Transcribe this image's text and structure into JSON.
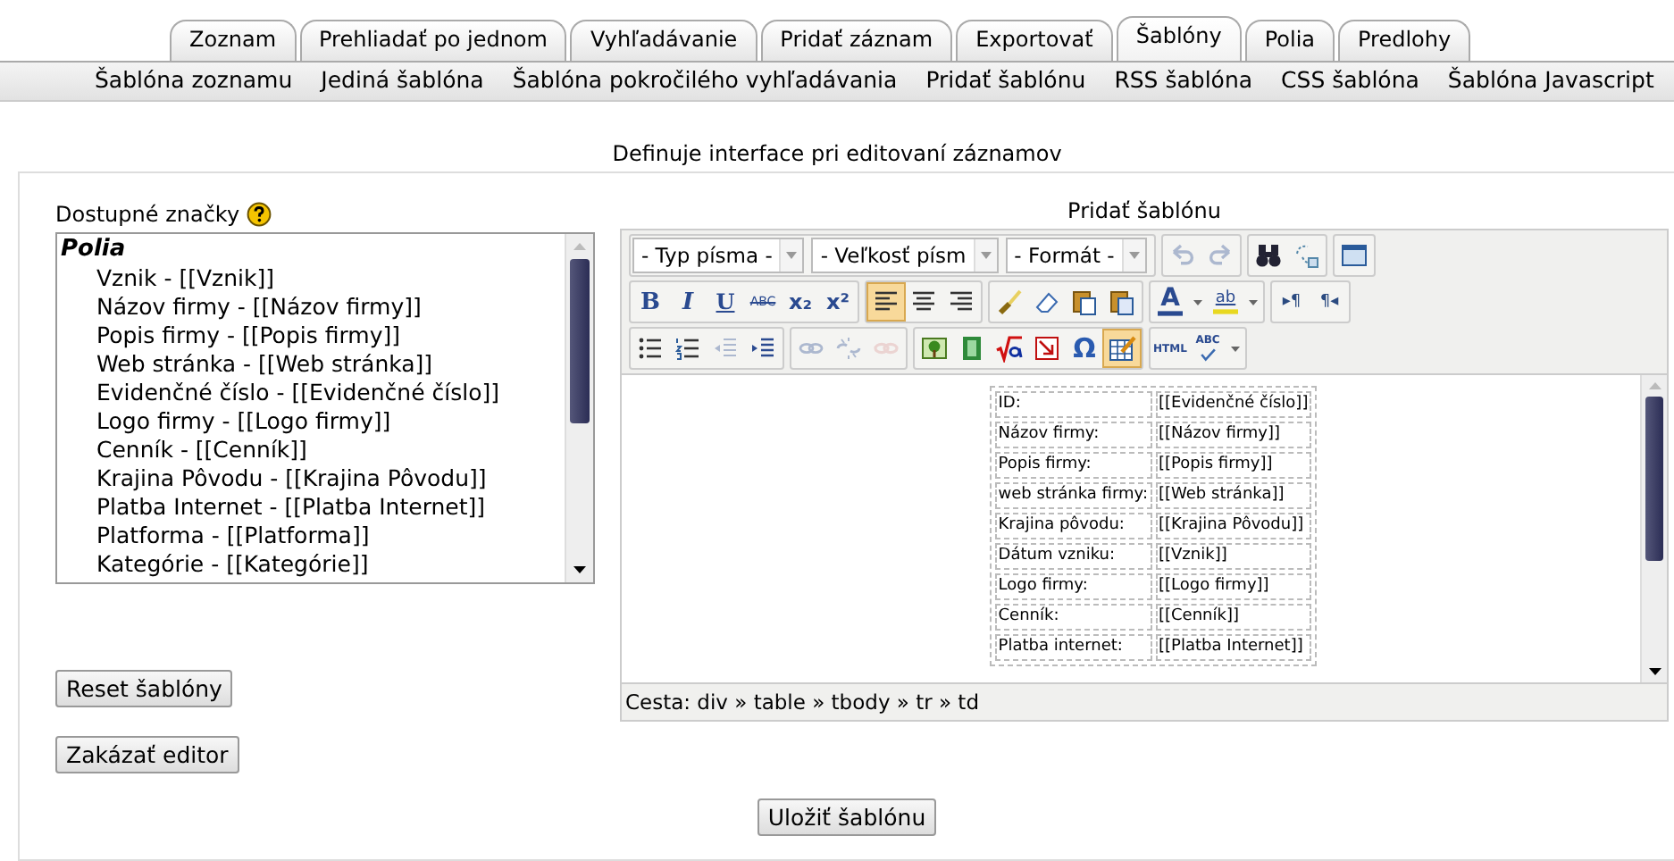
{
  "tabs": [
    {
      "label": "Zoznam",
      "selected": false
    },
    {
      "label": "Prehliadať po jednom",
      "selected": false
    },
    {
      "label": "Vyhľadávanie",
      "selected": false
    },
    {
      "label": "Pridať záznam",
      "selected": false
    },
    {
      "label": "Exportovať",
      "selected": false
    },
    {
      "label": "Šablóny",
      "selected": true
    },
    {
      "label": "Polia",
      "selected": false
    },
    {
      "label": "Predlohy",
      "selected": false
    }
  ],
  "subnav": [
    "Šablóna zoznamu",
    "Jediná šablóna",
    "Šablóna pokročilého vyhľadávania",
    "Pridať šablónu",
    "RSS šablóna",
    "CSS šablóna",
    "Šablóna Javascript"
  ],
  "caption": "Definuje interface pri editovaní záznamov",
  "tags_panel": {
    "label": "Dostupné značky",
    "group": "Polia",
    "items": [
      "Vznik - [[Vznik]]",
      "Názov firmy - [[Názov firmy]]",
      "Popis firmy - [[Popis firmy]]",
      "Web stránka - [[Web stránka]]",
      "Evidenčné číslo - [[Evidenčné číslo]]",
      "Logo firmy - [[Logo firmy]]",
      "Cenník - [[Cenník]]",
      "Krajina Pôvodu - [[Krajina Pôvodu]]",
      "Platba Internet - [[Platba Internet]]",
      "Platforma - [[Platforma]]",
      "Kategórie - [[Kategórie]]"
    ]
  },
  "editor": {
    "title": "Pridať šablónu",
    "toolbar": [
      [
        [
          {
            "kind": "select",
            "value": "- Typ písma -"
          },
          {
            "kind": "select",
            "value": "- Veľkosť písm"
          },
          {
            "kind": "select",
            "value": "- Formát -"
          }
        ],
        [
          {
            "kind": "undo",
            "selected": false,
            "disabled": true
          },
          {
            "kind": "redo",
            "selected": false,
            "disabled": true
          }
        ],
        [
          {
            "kind": "find",
            "selected": false,
            "disabled": false
          },
          {
            "kind": "replace",
            "selected": false,
            "disabled": false
          }
        ],
        [
          {
            "kind": "fullscreen",
            "selected": false,
            "disabled": false
          }
        ]
      ],
      [
        [
          {
            "kind": "bold",
            "label": "B",
            "selected": false,
            "disabled": false
          },
          {
            "kind": "italic",
            "label": "I",
            "selected": false,
            "disabled": false
          },
          {
            "kind": "underline",
            "label": "U",
            "selected": false,
            "disabled": false
          },
          {
            "kind": "strike",
            "label": "ABC",
            "selected": false,
            "disabled": false
          },
          {
            "kind": "sub",
            "label": "x₂",
            "selected": false,
            "disabled": false
          },
          {
            "kind": "sup",
            "label": "x²",
            "selected": false,
            "disabled": false
          }
        ],
        [
          {
            "kind": "align-left",
            "selected": true,
            "disabled": false
          },
          {
            "kind": "align-center",
            "selected": false,
            "disabled": false
          },
          {
            "kind": "align-right",
            "selected": false,
            "disabled": false
          }
        ],
        [
          {
            "kind": "cleanup",
            "selected": false,
            "disabled": false
          },
          {
            "kind": "eraser",
            "selected": false,
            "disabled": false
          },
          {
            "kind": "paste-text",
            "selected": false,
            "disabled": false
          },
          {
            "kind": "paste-word",
            "selected": false,
            "disabled": false
          }
        ],
        [
          {
            "kind": "forecolor",
            "label": "A",
            "selected": false,
            "disabled": false
          },
          {
            "kind": "highlight",
            "label": "ab",
            "selected": false,
            "disabled": false
          }
        ],
        [
          {
            "kind": "ltr",
            "label": "▸¶",
            "selected": false,
            "disabled": false
          },
          {
            "kind": "rtl",
            "label": "¶◂",
            "selected": false,
            "disabled": false
          }
        ]
      ],
      [
        [
          {
            "kind": "bullist",
            "selected": false,
            "disabled": false
          },
          {
            "kind": "numlist",
            "selected": false,
            "disabled": false
          },
          {
            "kind": "outdent",
            "selected": false,
            "disabled": true
          },
          {
            "kind": "indent",
            "selected": false,
            "disabled": false
          }
        ],
        [
          {
            "kind": "link",
            "selected": false,
            "disabled": true
          },
          {
            "kind": "unlink",
            "selected": false,
            "disabled": true
          },
          {
            "kind": "anchor",
            "selected": false,
            "disabled": true
          }
        ],
        [
          {
            "kind": "image",
            "selected": false,
            "disabled": false
          },
          {
            "kind": "media",
            "selected": false,
            "disabled": false
          },
          {
            "kind": "math",
            "selected": false,
            "disabled": false
          },
          {
            "kind": "nonbreaking",
            "selected": false,
            "disabled": false
          },
          {
            "kind": "charmap",
            "label": "Ω",
            "selected": false,
            "disabled": false
          },
          {
            "kind": "table",
            "selected": true,
            "disabled": false
          }
        ],
        [
          {
            "kind": "html",
            "label": "HTML",
            "selected": false,
            "disabled": false
          },
          {
            "kind": "spellcheck",
            "label": "ABC",
            "selected": false,
            "disabled": false
          }
        ]
      ]
    ],
    "rows": [
      {
        "label": "ID:",
        "value": "[[Evidenčné číslo]]"
      },
      {
        "label": "Názov firmy:",
        "value": "[[Názov firmy]]"
      },
      {
        "label": "Popis firmy:",
        "value": "[[Popis firmy]]"
      },
      {
        "label": "web stránka firmy:",
        "value": "[[Web stránka]]"
      },
      {
        "label": "Krajina pôvodu:",
        "value": "[[Krajina Pôvodu]]"
      },
      {
        "label": "Dátum vzniku:",
        "value": "[[Vznik]]"
      },
      {
        "label": "Logo firmy:",
        "value": "[[Logo firmy]]"
      },
      {
        "label": "Cenník:",
        "value": "[[Cenník]]"
      },
      {
        "label": "Platba internet:",
        "value": "[[Platba Internet]]"
      }
    ],
    "path": "Cesta: div » table » tbody » tr » td"
  },
  "buttons": {
    "reset": "Reset šablóny",
    "disable_editor": "Zakázať editor",
    "save": "Uložiť šablónu"
  }
}
